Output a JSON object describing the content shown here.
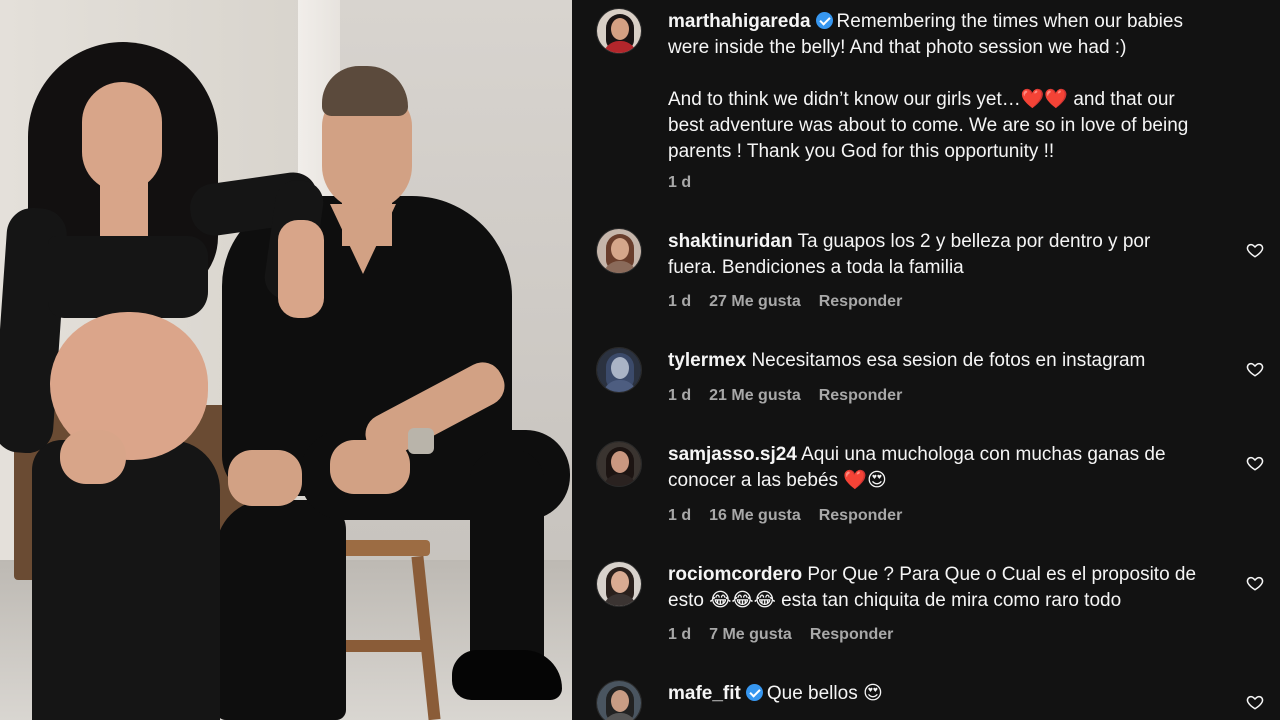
{
  "caption": {
    "username": "marthahigareda",
    "verified": true,
    "text_line1": "Remembering the times when our babies",
    "text_line2": "were inside the belly! And that photo session we had :)",
    "text_para2": "And to think we didn’t know our girls yet…❤️❤️ and that our\nbest adventure was about to come. We are so in love of being\nparents ! Thank you God for this opportunity !!",
    "time": "1 d"
  },
  "comments": [
    {
      "username": "shaktinuridan",
      "text": "Ta guapos los 2 y belleza por dentro y por\nfuera. Bendiciones a toda la familia",
      "time": "1 d",
      "likes": "27 Me gusta",
      "reply": "Responder"
    },
    {
      "username": "tylermex",
      "text": "Necesitamos esa sesion de fotos en instagram",
      "time": "1 d",
      "likes": "21 Me gusta",
      "reply": "Responder"
    },
    {
      "username": "samjasso.sj24",
      "text": "Aqui una muchologa con muchas ganas de\nconocer a las bebés ❤️😍",
      "time": "1 d",
      "likes": "16 Me gusta",
      "reply": "Responder"
    },
    {
      "username": "rociomcordero",
      "text": "Por Que ? Para Que o Cual es el proposito de\nesto 😂😂😂 esta tan chiquita de mira como raro todo",
      "time": "1 d",
      "likes": "7 Me gusta",
      "reply": "Responder"
    },
    {
      "username": "mafe_fit",
      "verified": true,
      "text": "Que bellos 😍"
    }
  ],
  "icons": {
    "like": "heart-outline-icon",
    "verified": "verified-badge-icon"
  },
  "colors": {
    "background": "#121212",
    "text": "#f5f5f5",
    "secondary_text": "#a8a8a8",
    "verified": "#3797f0"
  }
}
